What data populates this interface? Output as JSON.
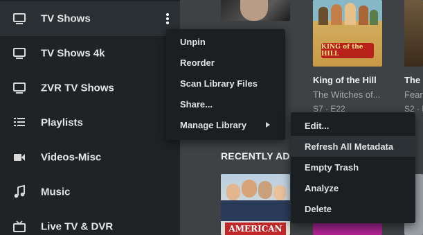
{
  "sidebar": {
    "items": [
      {
        "label": "TV Shows",
        "icon": "monitor-icon",
        "active": true
      },
      {
        "label": "TV Shows 4k",
        "icon": "monitor-icon"
      },
      {
        "label": "ZVR TV Shows",
        "icon": "monitor-icon"
      },
      {
        "label": "Playlists",
        "icon": "list-icon"
      },
      {
        "label": "Videos-Misc",
        "icon": "video-camera-icon"
      },
      {
        "label": "Music",
        "icon": "music-note-icon"
      },
      {
        "label": "Live TV & DVR",
        "icon": "tv-antenna-icon"
      }
    ]
  },
  "context_menu": {
    "items": [
      {
        "label": "Unpin"
      },
      {
        "label": "Reorder"
      },
      {
        "label": "Scan Library Files"
      },
      {
        "label": "Share..."
      },
      {
        "label": "Manage Library",
        "has_submenu": true
      }
    ]
  },
  "submenu": {
    "items": [
      {
        "label": "Edit..."
      },
      {
        "label": "Refresh All Metadata",
        "highlighted": true
      },
      {
        "label": "Empty Trash"
      },
      {
        "label": "Analyze"
      },
      {
        "label": "Delete"
      }
    ]
  },
  "main": {
    "posters": [
      {
        "title": "King of the Hill",
        "subtitle": "The Witches of...",
        "meta": "S7 · E22",
        "poster_text": "KING of the HILL"
      },
      {
        "title": "The",
        "subtitle": "Fear",
        "meta": "S2 · E",
        "poster_text": ""
      }
    ],
    "section_header": "RECENTLY AD",
    "recent_posters": [
      {
        "poster_text": "AMERICAN"
      }
    ]
  },
  "colors": {
    "sidebar_bg": "#1f2326",
    "sidebar_active": "#2b3034",
    "main_bg": "#3f4245",
    "menu_bg": "#1c1f22",
    "menu_hover": "#2c3135"
  }
}
